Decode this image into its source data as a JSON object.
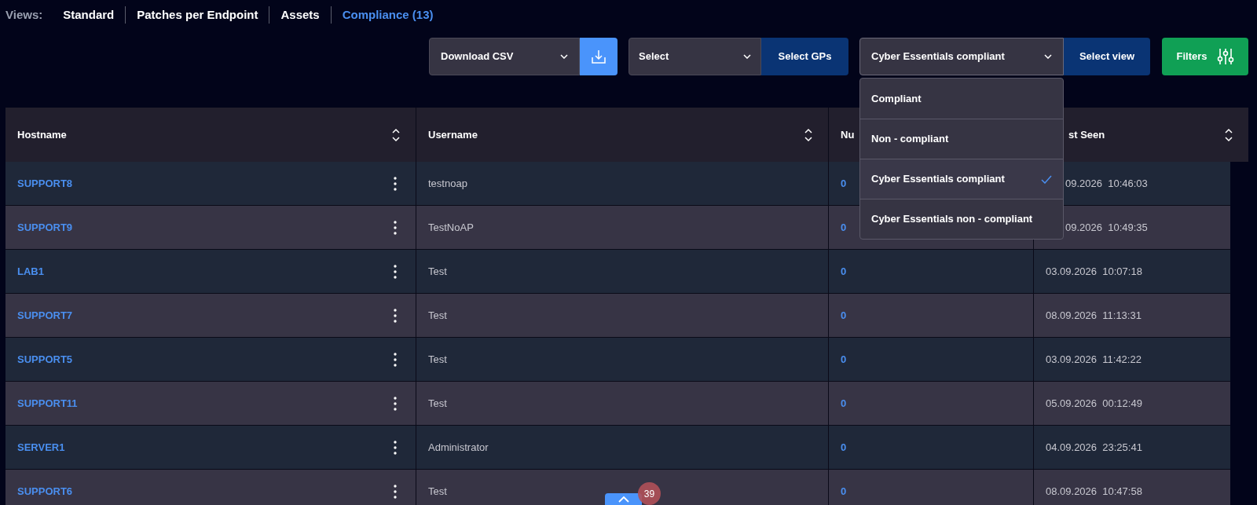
{
  "views": {
    "label": "Views:",
    "tabs": [
      {
        "label": "Standard",
        "selected": false
      },
      {
        "label": "Patches per Endpoint",
        "selected": false
      },
      {
        "label": "Assets",
        "selected": false
      },
      {
        "label": "Compliance (13)",
        "selected": true
      }
    ]
  },
  "toolbar": {
    "export": {
      "value": "Download CSV"
    },
    "gp_select": {
      "value": "Select",
      "button": "Select GPs"
    },
    "view_select": {
      "value": "Cyber Essentials compliant",
      "expanded": true,
      "button": "Select view",
      "options": [
        {
          "label": "Compliant",
          "selected": false
        },
        {
          "label": "Non - compliant",
          "selected": false
        },
        {
          "label": "Cyber Essentials compliant",
          "selected": true
        },
        {
          "label": "Cyber Essentials non - compliant",
          "selected": false
        }
      ]
    },
    "filters": "Filters"
  },
  "table": {
    "columns": [
      "Hostname",
      "Username",
      "Nu",
      "st Seen"
    ],
    "rows": [
      {
        "hostname": "SUPPORT8",
        "username": "testnoap",
        "count": "0",
        "last_seen": "09.2026  10:46:03"
      },
      {
        "hostname": "SUPPORT9",
        "username": "TestNoAP",
        "count": "0",
        "last_seen": "09.2026  10:49:35"
      },
      {
        "hostname": "LAB1",
        "username": "Test",
        "count": "0",
        "last_seen": "03.09.2026  10:07:18"
      },
      {
        "hostname": "SUPPORT7",
        "username": "Test",
        "count": "0",
        "last_seen": "08.09.2026  11:13:31"
      },
      {
        "hostname": "SUPPORT5",
        "username": "Test",
        "count": "0",
        "last_seen": "03.09.2026  11:42:22"
      },
      {
        "hostname": "SUPPORT11",
        "username": "Test",
        "count": "0",
        "last_seen": "05.09.2026  00:12:49"
      },
      {
        "hostname": "SERVER1",
        "username": "Administrator",
        "count": "0",
        "last_seen": "04.09.2026  23:25:41"
      },
      {
        "hostname": "SUPPORT6",
        "username": "Test",
        "count": "0",
        "last_seen": "08.09.2026  10:47:58"
      }
    ]
  },
  "scroll_top": {
    "badge": "39"
  }
}
